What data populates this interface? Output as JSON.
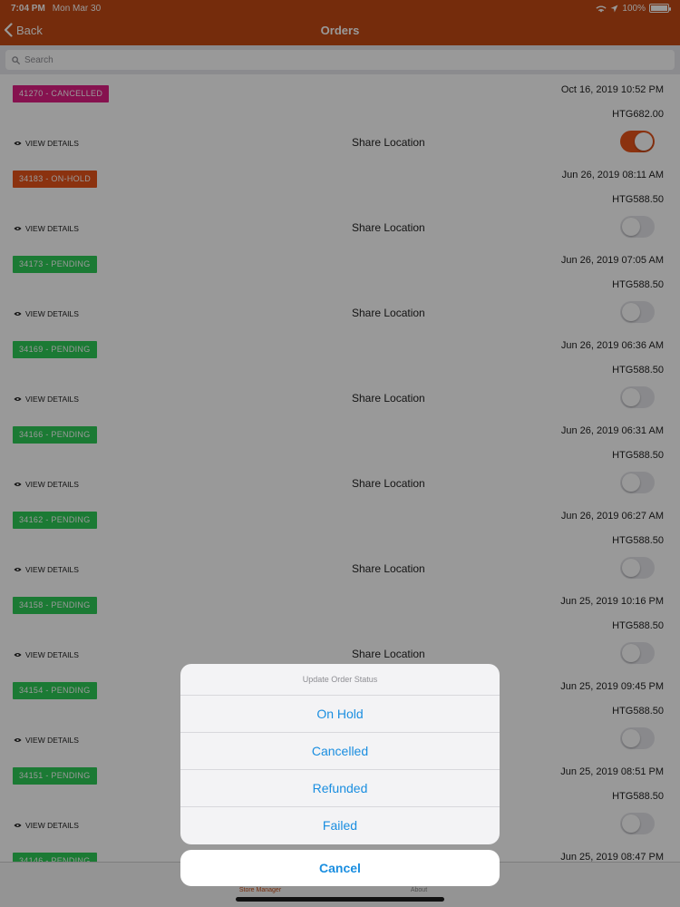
{
  "status_bar": {
    "time": "7:04 PM",
    "date": "Mon Mar 30",
    "battery": "100%"
  },
  "nav": {
    "back_label": "Back",
    "title": "Orders"
  },
  "search": {
    "placeholder": "Search"
  },
  "orders": [
    {
      "badge": "41270 - CANCELLED",
      "status": "cancelled",
      "date": "Oct 16, 2019 10:52 PM",
      "amount": "HTG682.00",
      "view_details": "VIEW DETAILS",
      "share_label": "Share Location",
      "share_on": true
    },
    {
      "badge": "34183 - ON-HOLD",
      "status": "on-hold",
      "date": "Jun 26, 2019 08:11 AM",
      "amount": "HTG588.50",
      "view_details": "VIEW DETAILS",
      "share_label": "Share Location",
      "share_on": false
    },
    {
      "badge": "34173 - PENDING",
      "status": "pending",
      "date": "Jun 26, 2019 07:05 AM",
      "amount": "HTG588.50",
      "view_details": "VIEW DETAILS",
      "share_label": "Share Location",
      "share_on": false
    },
    {
      "badge": "34169 - PENDING",
      "status": "pending",
      "date": "Jun 26, 2019 06:36 AM",
      "amount": "HTG588.50",
      "view_details": "VIEW DETAILS",
      "share_label": "Share Location",
      "share_on": false
    },
    {
      "badge": "34166 - PENDING",
      "status": "pending",
      "date": "Jun 26, 2019 06:31 AM",
      "amount": "HTG588.50",
      "view_details": "VIEW DETAILS",
      "share_label": "Share Location",
      "share_on": false
    },
    {
      "badge": "34162 - PENDING",
      "status": "pending",
      "date": "Jun 26, 2019 06:27 AM",
      "amount": "HTG588.50",
      "view_details": "VIEW DETAILS",
      "share_label": "Share Location",
      "share_on": false
    },
    {
      "badge": "34158 - PENDING",
      "status": "pending",
      "date": "Jun 25, 2019 10:16 PM",
      "amount": "HTG588.50",
      "view_details": "VIEW DETAILS",
      "share_label": "Share Location",
      "share_on": false
    },
    {
      "badge": "34154 - PENDING",
      "status": "pending",
      "date": "Jun 25, 2019 09:45 PM",
      "amount": "HTG588.50",
      "view_details": "VIEW DETAILS",
      "share_label": "",
      "share_on": false
    },
    {
      "badge": "34151 - PENDING",
      "status": "pending",
      "date": "Jun 25, 2019 08:51 PM",
      "amount": "HTG588.50",
      "view_details": "VIEW DETAILS",
      "share_label": "",
      "share_on": false
    },
    {
      "badge": "34146 - PENDING",
      "status": "pending",
      "date": "Jun 25, 2019 08:47 PM",
      "amount": "",
      "view_details": "",
      "share_label": "",
      "share_on": false
    }
  ],
  "tabs": [
    {
      "label": "Store Manager"
    },
    {
      "label": "About"
    }
  ],
  "action_sheet": {
    "title": "Update Order Status",
    "options": [
      "On Hold",
      "Cancelled",
      "Refunded",
      "Failed"
    ],
    "cancel_label": "Cancel"
  },
  "colors": {
    "brand": "#c44a14",
    "cancelled": "#e01e84",
    "on_hold": "#e8541a",
    "pending": "#2ecc57",
    "action_blue": "#1a8ee0"
  },
  "icons": {
    "back": "chevron-left-icon",
    "search": "search-icon",
    "view": "eye-icon",
    "wifi": "wifi-icon",
    "location": "location-arrow-icon",
    "battery": "battery-icon"
  }
}
